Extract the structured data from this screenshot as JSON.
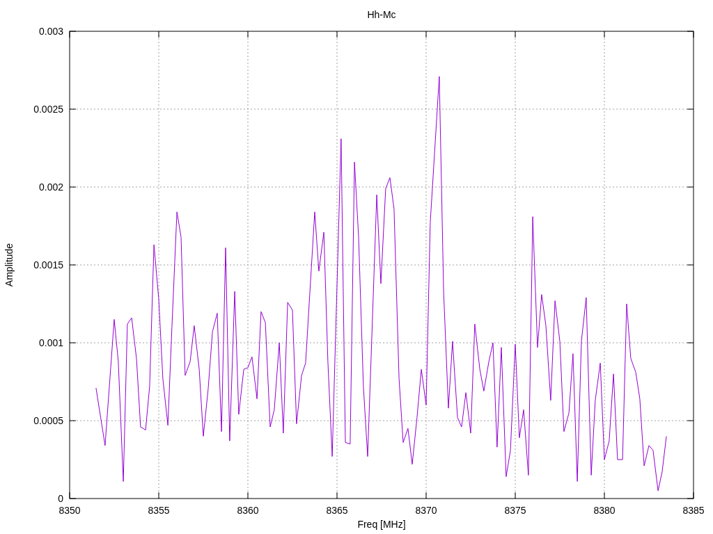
{
  "chart_data": {
    "type": "line",
    "grid": true,
    "title": "Hh-Mc",
    "xlabel": "Freq [MHz]",
    "ylabel": "Amplitude",
    "xlim": [
      8350,
      8385
    ],
    "ylim": [
      0,
      0.003
    ],
    "xticks": [
      8350,
      8355,
      8360,
      8365,
      8370,
      8375,
      8380,
      8385
    ],
    "yticks": [
      {
        "value": 0,
        "label": "0"
      },
      {
        "value": 0.0005,
        "label": "0.0005"
      },
      {
        "value": 0.001,
        "label": "0.001"
      },
      {
        "value": 0.0015,
        "label": "0.0015"
      },
      {
        "value": 0.002,
        "label": "0.002"
      },
      {
        "value": 0.0025,
        "label": "0.0025"
      },
      {
        "value": 0.003,
        "label": "0.003"
      }
    ],
    "x": [
      8351.48,
      8351.99,
      8352.5,
      8352.73,
      8353.01,
      8353.24,
      8353.48,
      8353.75,
      8353.98,
      8354.26,
      8354.49,
      8354.73,
      8355.0,
      8355.23,
      8355.51,
      8355.74,
      8356.02,
      8356.25,
      8356.48,
      8356.76,
      8356.99,
      8357.27,
      8357.5,
      8357.77,
      8358.01,
      8358.28,
      8358.52,
      8358.75,
      8358.98,
      8359.26,
      8359.49,
      8359.77,
      8360.0,
      8360.23,
      8360.51,
      8360.74,
      8360.98,
      8361.25,
      8361.48,
      8361.76,
      8361.99,
      8362.23,
      8362.5,
      8362.73,
      8363.01,
      8363.24,
      8363.75,
      8363.98,
      8364.26,
      8364.49,
      8364.73,
      8365.23,
      8365.47,
      8365.74,
      8365.98,
      8366.21,
      8366.48,
      8366.72,
      8367.23,
      8367.46,
      8367.73,
      8367.97,
      8368.2,
      8368.48,
      8368.71,
      8368.98,
      8369.22,
      8369.49,
      8369.73,
      8370.0,
      8370.23,
      8370.74,
      8370.98,
      8371.25,
      8371.48,
      8371.76,
      8371.99,
      8372.23,
      8372.5,
      8372.73,
      8373.01,
      8373.24,
      8373.52,
      8373.75,
      8373.98,
      8374.22,
      8374.49,
      8374.73,
      8375.0,
      8375.23,
      8375.47,
      8375.74,
      8375.98,
      8376.25,
      8376.48,
      8376.72,
      8376.99,
      8377.23,
      8377.5,
      8377.73,
      8378.01,
      8378.24,
      8378.48,
      8378.71,
      8378.98,
      8379.26,
      8379.49,
      8379.77,
      8380.0,
      8380.27,
      8380.51,
      8380.74,
      8381.02,
      8381.25,
      8381.48,
      8381.76,
      8381.99,
      8382.23,
      8382.5,
      8382.73,
      8383.01,
      8383.24,
      8383.48
    ],
    "series": [
      {
        "color": "#9400d3",
        "values": [
          0.00071,
          0.00034,
          0.00115,
          0.00088,
          0.00011,
          0.00112,
          0.00116,
          0.0009,
          0.00046,
          0.00044,
          0.00072,
          0.00163,
          0.00128,
          0.00077,
          0.00047,
          0.0011,
          0.00184,
          0.00168,
          0.00079,
          0.00088,
          0.00111,
          0.00083,
          0.0004,
          0.0007,
          0.00107,
          0.00119,
          0.00043,
          0.00161,
          0.00037,
          0.00133,
          0.00054,
          0.00083,
          0.00084,
          0.00091,
          0.00064,
          0.0012,
          0.00113,
          0.00046,
          0.00057,
          0.001,
          0.00042,
          0.00126,
          0.00121,
          0.00048,
          0.00079,
          0.00087,
          0.00184,
          0.00146,
          0.00171,
          0.00088,
          0.00027,
          0.00231,
          0.00036,
          0.00035,
          0.00216,
          0.00168,
          0.00072,
          0.00027,
          0.00195,
          0.00138,
          0.00199,
          0.00206,
          0.00186,
          0.00077,
          0.00036,
          0.00045,
          0.00022,
          0.00052,
          0.00083,
          0.0006,
          0.00177,
          0.00271,
          0.00133,
          0.00058,
          0.00101,
          0.00052,
          0.00046,
          0.00068,
          0.00042,
          0.00112,
          0.00083,
          0.00069,
          0.00088,
          0.001,
          0.00033,
          0.00097,
          0.00014,
          0.00031,
          0.00099,
          0.00039,
          0.00057,
          0.00015,
          0.00181,
          0.00097,
          0.00131,
          0.00111,
          0.00063,
          0.00127,
          0.00101,
          0.00043,
          0.00055,
          0.00093,
          0.00011,
          0.00101,
          0.00129,
          0.00015,
          0.00063,
          0.00087,
          0.00025,
          0.00037,
          0.0008,
          0.00025,
          0.00025,
          0.00125,
          0.0009,
          0.00081,
          0.00064,
          0.00021,
          0.00034,
          0.00031,
          5e-05,
          0.00017,
          0.0004
        ]
      }
    ]
  }
}
